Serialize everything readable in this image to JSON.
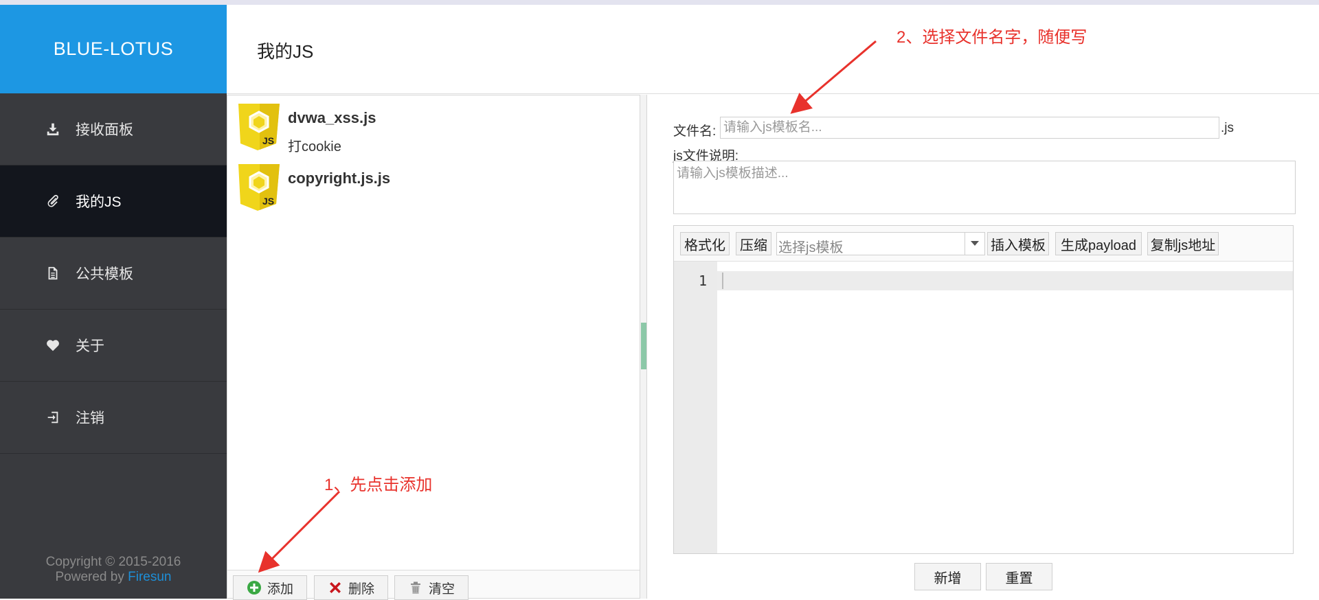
{
  "sidebar": {
    "brand": "BLUE-LOTUS",
    "items": [
      {
        "label": "接收面板",
        "icon": "download-icon"
      },
      {
        "label": "我的JS",
        "icon": "paperclip-icon"
      },
      {
        "label": "公共模板",
        "icon": "document-icon"
      },
      {
        "label": "关于",
        "icon": "heart-icon"
      },
      {
        "label": "注销",
        "icon": "logout-icon"
      }
    ],
    "active_index": 1,
    "copyright_line1": "Copyright © 2015-2016",
    "powered_by": "Powered by",
    "powered_by_link": "Firesun"
  },
  "header": {
    "title": "我的JS"
  },
  "js_list": {
    "items": [
      {
        "name": "dvwa_xss.js",
        "desc": "打cookie",
        "icon": "js-badge-icon"
      },
      {
        "name": "copyright.js.js",
        "desc": "",
        "icon": "js-badge-icon"
      }
    ],
    "buttons": {
      "add": "添加",
      "delete": "删除",
      "clear": "清空"
    }
  },
  "form": {
    "filename_label": "文件名:",
    "filename_placeholder": "请输入js模板名...",
    "filename_value": "",
    "filename_suffix": ".js",
    "desc_label": "js文件说明:",
    "desc_placeholder": "请输入js模板描述...",
    "desc_value": ""
  },
  "editor": {
    "toolbar": {
      "format": "格式化",
      "compress": "压缩",
      "template_select_placeholder": "选择js模板",
      "insert_template": "插入模板",
      "gen_payload": "生成payload",
      "copy_js_url": "复制js地址"
    },
    "line_numbers": [
      "1"
    ],
    "content": ""
  },
  "footer_buttons": {
    "add": "新增",
    "reset": "重置"
  },
  "annotations": {
    "step1": "1、先点击添加",
    "step2": "2、选择文件名字，随便写",
    "color": "#e8322c"
  },
  "colors": {
    "brand_bg": "#1d97e3",
    "sidebar_bg": "#393a3e",
    "sidebar_active_bg": "#13161d",
    "js_badge": "#f0d51b"
  }
}
